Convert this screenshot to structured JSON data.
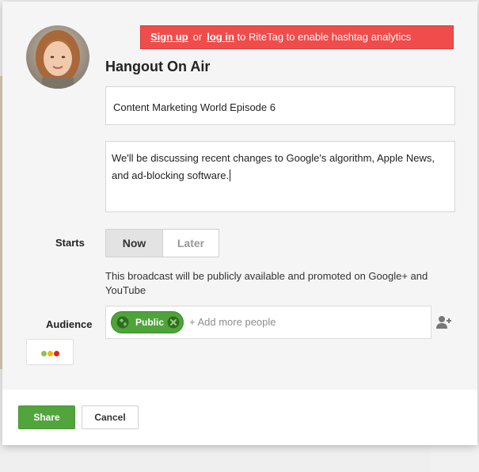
{
  "banner": {
    "signup": "Sign up",
    "or": "or",
    "login": "log in",
    "rest": "to RiteTag to enable hashtag analytics"
  },
  "dialog": {
    "title": "Hangout On Air",
    "event_name": "Content Marketing World Episode 6",
    "description": "We'll be discussing recent changes to Google's algorithm, Apple News, and ad-blocking software."
  },
  "starts": {
    "label": "Starts",
    "options": [
      "Now",
      "Later"
    ],
    "selected": "Now"
  },
  "notice": "This broadcast will be publicly available and promoted on Google+ and YouTube",
  "audience": {
    "label": "Audience",
    "chip": "Public",
    "placeholder": "+ Add more people"
  },
  "actions": {
    "share": "Share",
    "cancel": "Cancel"
  },
  "icons": {
    "globe": "globe-icon",
    "remove": "close-circle-icon",
    "add_person": "add-person-icon"
  },
  "colors": {
    "banner": "#f04c4c",
    "accent_green": "#52a43c",
    "dot_green": "#8bc34a",
    "dot_yellow": "#f5b800",
    "dot_red": "#e02020"
  }
}
